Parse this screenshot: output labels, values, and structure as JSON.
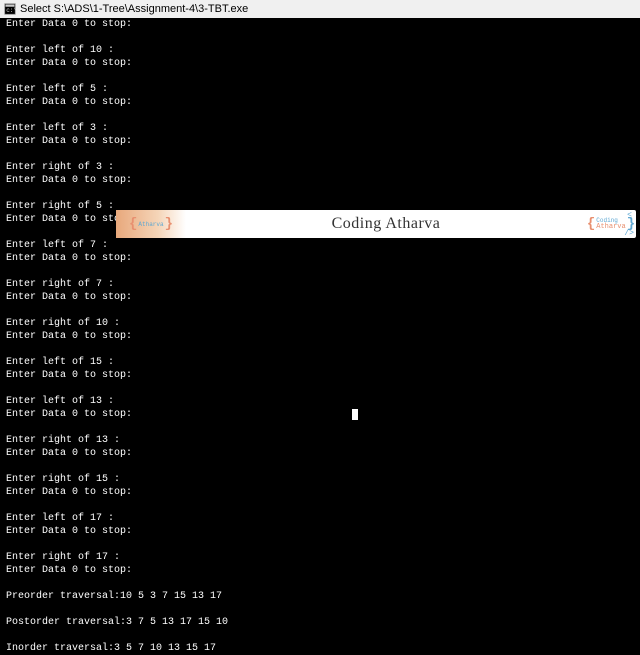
{
  "titlebar": {
    "prefix": "Select",
    "path": "S:\\ADS\\1-Tree\\Assignment-4\\3-TBT.exe"
  },
  "console": {
    "lines": [
      "Enter Data 0 to stop:",
      "",
      "Enter left of 10 :",
      "Enter Data 0 to stop:",
      "",
      "Enter left of 5 :",
      "Enter Data 0 to stop:",
      "",
      "Enter left of 3 :",
      "Enter Data 0 to stop:",
      "",
      "Enter right of 3 :",
      "Enter Data 0 to stop:",
      "",
      "Enter right of 5 :",
      "Enter Data 0 to stop:",
      "",
      "Enter left of 7 :",
      "Enter Data 0 to stop:",
      "",
      "Enter right of 7 :",
      "Enter Data 0 to stop:",
      "",
      "Enter right of 10 :",
      "Enter Data 0 to stop:",
      "",
      "Enter left of 15 :",
      "Enter Data 0 to stop:",
      "",
      "Enter left of 13 :",
      "Enter Data 0 to stop:",
      "",
      "Enter right of 13 :",
      "Enter Data 0 to stop:",
      "",
      "Enter right of 15 :",
      "Enter Data 0 to stop:",
      "",
      "Enter left of 17 :",
      "Enter Data 0 to stop:",
      "",
      "Enter right of 17 :",
      "Enter Data 0 to stop:",
      "",
      "Preorder traversal:10 5 3 7 15 13 17",
      "",
      "Postorder traversal:3 7 5 13 17 15 10",
      "",
      "Inorder traversal:3 5 7 10 13 15 17"
    ],
    "cursor_after_line": 30
  },
  "watermark": {
    "text": "Coding Atharva",
    "left_label": "Atharva",
    "right_top": "Coding",
    "right_bottom": "Atharva"
  }
}
